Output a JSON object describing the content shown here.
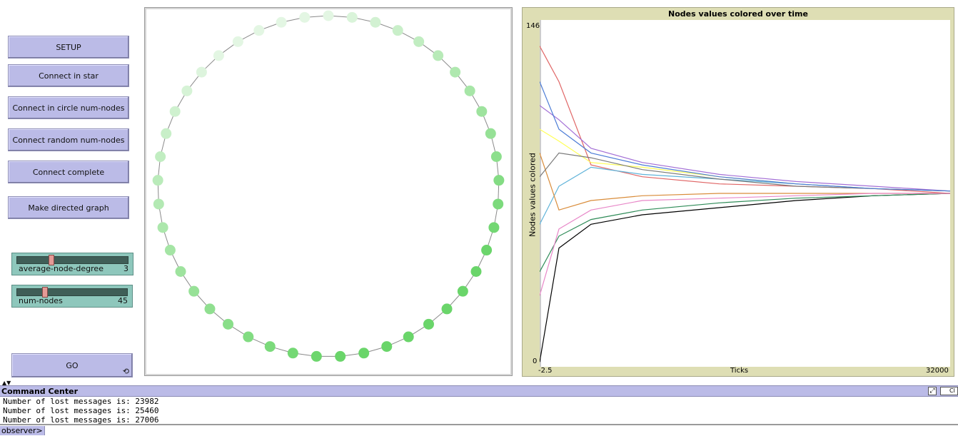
{
  "buttons": {
    "setup": "SETUP",
    "star": "Connect in star",
    "circle": "Connect in circle num-nodes",
    "random": "Connect random num-nodes",
    "complete": "Connect complete",
    "directed": "Make directed graph",
    "go": "GO",
    "go_icon": "⟲"
  },
  "sliders": {
    "avg_degree": {
      "label": "average-node-degree",
      "value": "3",
      "fraction": 0.28
    },
    "num_nodes": {
      "label": "num-nodes",
      "value": "45",
      "fraction": 0.22
    }
  },
  "network": {
    "node_count": 45,
    "color_light": "#e3f6e3",
    "color_dark": "#6ad56a"
  },
  "chart_data": {
    "type": "line",
    "title": "Nodes values colored over time",
    "xlabel": "Ticks",
    "ylabel": "Nodes values colored",
    "x_tick_labels": [
      "-2.5",
      "32000"
    ],
    "y_tick_labels": [
      "0",
      "146"
    ],
    "xlim": [
      -2.5,
      32000
    ],
    "ylim": [
      0,
      146
    ],
    "series": [
      {
        "color": "#e06666",
        "x": [
          0,
          1500,
          4000,
          8000,
          14000,
          20000,
          26000,
          32000
        ],
        "values": [
          135,
          120,
          85,
          80,
          77,
          76,
          75,
          73
        ]
      },
      {
        "color": "#000000",
        "x": [
          0,
          1500,
          4000,
          8000,
          14000,
          20000,
          26000,
          32000
        ],
        "values": [
          2,
          50,
          60,
          64,
          67,
          70,
          72,
          73
        ]
      },
      {
        "color": "#ffff55",
        "x": [
          0,
          1500,
          4000,
          8000,
          14000,
          20000,
          26000,
          32000
        ],
        "values": [
          100,
          95,
          86,
          84,
          80,
          77,
          75,
          74
        ]
      },
      {
        "color": "#5fb3d9",
        "x": [
          0,
          1500,
          4000,
          8000,
          14000,
          20000,
          26000,
          32000
        ],
        "values": [
          60,
          76,
          84,
          81,
          79,
          77,
          75,
          74
        ]
      },
      {
        "color": "#a36fd6",
        "x": [
          0,
          1500,
          4000,
          8000,
          14000,
          20000,
          26000,
          32000
        ],
        "values": [
          110,
          104,
          92,
          86,
          81,
          78,
          76,
          74
        ]
      },
      {
        "color": "#2e8b57",
        "x": [
          0,
          1500,
          4000,
          8000,
          14000,
          20000,
          26000,
          32000
        ],
        "values": [
          40,
          55,
          62,
          66,
          69,
          71,
          72,
          73
        ]
      },
      {
        "color": "#d98c3a",
        "x": [
          0,
          1500,
          4000,
          8000,
          14000,
          20000,
          26000,
          32000
        ],
        "values": [
          90,
          66,
          70,
          72,
          73,
          73,
          73,
          73
        ]
      },
      {
        "color": "#7a7a7a",
        "x": [
          0,
          1500,
          4000,
          8000,
          14000,
          20000,
          26000,
          32000
        ],
        "values": [
          80,
          90,
          88,
          83,
          79,
          76,
          75,
          74
        ]
      },
      {
        "color": "#e887c8",
        "x": [
          0,
          1500,
          4000,
          8000,
          14000,
          20000,
          26000,
          32000
        ],
        "values": [
          30,
          58,
          66,
          70,
          71,
          72,
          73,
          73
        ]
      },
      {
        "color": "#4c7cd6",
        "x": [
          0,
          1500,
          4000,
          8000,
          14000,
          20000,
          26000,
          32000
        ],
        "values": [
          120,
          100,
          90,
          85,
          80,
          77,
          75,
          74
        ]
      }
    ]
  },
  "command_center": {
    "title": "Command Center",
    "clear_label": "Cl",
    "lines": [
      "Number of lost messages is: 23982",
      "Number of lost messages is: 25460",
      "Number of lost messages is: 27006"
    ],
    "prompt": "observer>",
    "input_value": ""
  }
}
